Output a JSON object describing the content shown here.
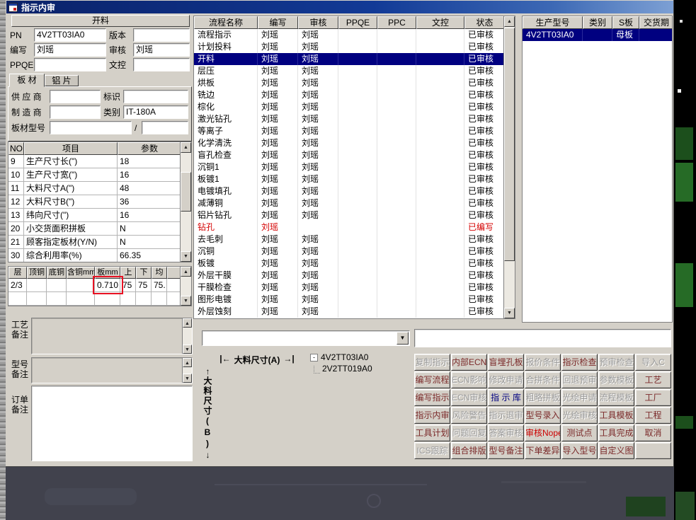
{
  "window": {
    "title": "指示内审"
  },
  "icons": {
    "minus": "-",
    "dropdown": "▼",
    "up": "▲",
    "down": "▼",
    "arrow_up": "↑",
    "arrow_down": "↓",
    "left_cap": "|←",
    "right_cap": "→|",
    "slash": "/"
  },
  "left": {
    "section_header": "开料",
    "form": {
      "pn_label": "PN",
      "pn_value": "4V2TT03IA0",
      "version_label": "版本",
      "version_value": "",
      "writer_label": "编写",
      "writer_value": "刘瑶",
      "audit_label": "审核",
      "audit_value": "刘瑶",
      "ppqe_label": "PPQE",
      "ppqe_value": "",
      "doc_label": "文控",
      "doc_value": ""
    },
    "tabs": [
      {
        "label": "板 材"
      },
      {
        "label": "铝 片"
      }
    ],
    "material": {
      "supplier_label": "供 应 商",
      "supplier_value": "",
      "mark_label": "标识",
      "mark_value": "",
      "manufacturer_label": "制 造 商",
      "manufacturer_value": "",
      "category_label": "类别",
      "category_value": "IT-180A",
      "board_model_label": "板材型号",
      "board_model_value": "",
      "board_model_value2": ""
    },
    "param_table": {
      "headers": [
        "NO",
        "项目",
        "参数"
      ],
      "rows": [
        [
          "9",
          "生产尺寸长(\")",
          "18"
        ],
        [
          "10",
          "生产尺寸宽(\")",
          "16"
        ],
        [
          "11",
          "大料尺寸A(\")",
          "48"
        ],
        [
          "12",
          "大料尺寸B(\")",
          "36"
        ],
        [
          "13",
          "纬向尺寸(\")",
          "16"
        ],
        [
          "20",
          "小交货面积拼板",
          "N"
        ],
        [
          "21",
          "顾客指定板材(Y/N)",
          "N"
        ],
        [
          "30",
          "综合利用率(%)",
          "66.35"
        ]
      ]
    },
    "copper_table": {
      "headers": [
        "层",
        "顶铜",
        "底铜",
        "含铜mm",
        "板mm",
        "上",
        "下",
        "均"
      ],
      "rows": [
        [
          "2/3",
          "",
          "",
          "",
          "0.710",
          "75",
          "75",
          "75."
        ],
        [
          "",
          "",
          "",
          "",
          "",
          "",
          "",
          ""
        ]
      ]
    },
    "notes": {
      "process_label": "工艺备注",
      "model_label": "型号备注",
      "order_label": "订单备注"
    }
  },
  "flow_table": {
    "headers": [
      "流程名称",
      "编写",
      "审核",
      "PPQE",
      "PPC",
      "文控",
      "状态"
    ],
    "selected_index": 2,
    "rows": [
      {
        "name": "流程指示",
        "writer": "刘瑶",
        "auditor": "刘瑶",
        "status": "已审核"
      },
      {
        "name": "计划投料",
        "writer": "刘瑶",
        "auditor": "刘瑶",
        "status": "已审核"
      },
      {
        "name": "开料",
        "writer": "刘瑶",
        "auditor": "刘瑶",
        "status": "已审核"
      },
      {
        "name": "层压",
        "writer": "刘瑶",
        "auditor": "刘瑶",
        "status": "已审核"
      },
      {
        "name": "烘板",
        "writer": "刘瑶",
        "auditor": "刘瑶",
        "status": "已审核"
      },
      {
        "name": "铣边",
        "writer": "刘瑶",
        "auditor": "刘瑶",
        "status": "已审核"
      },
      {
        "name": "棕化",
        "writer": "刘瑶",
        "auditor": "刘瑶",
        "status": "已审核"
      },
      {
        "name": "激光钻孔",
        "writer": "刘瑶",
        "auditor": "刘瑶",
        "status": "已审核"
      },
      {
        "name": "等离子",
        "writer": "刘瑶",
        "auditor": "刘瑶",
        "status": "已审核"
      },
      {
        "name": "化学清洗",
        "writer": "刘瑶",
        "auditor": "刘瑶",
        "status": "已审核"
      },
      {
        "name": "盲孔检查",
        "writer": "刘瑶",
        "auditor": "刘瑶",
        "status": "已审核"
      },
      {
        "name": "沉铜1",
        "writer": "刘瑶",
        "auditor": "刘瑶",
        "status": "已审核"
      },
      {
        "name": "板镀1",
        "writer": "刘瑶",
        "auditor": "刘瑶",
        "status": "已审核"
      },
      {
        "name": "电镀填孔",
        "writer": "刘瑶",
        "auditor": "刘瑶",
        "status": "已审核"
      },
      {
        "name": "减薄铜",
        "writer": "刘瑶",
        "auditor": "刘瑶",
        "status": "已审核"
      },
      {
        "name": "铝片钻孔",
        "writer": "刘瑶",
        "auditor": "刘瑶",
        "status": "已审核"
      },
      {
        "name": "钻孔",
        "writer": "刘瑶",
        "auditor": "",
        "status": "已编写",
        "red": true
      },
      {
        "name": "去毛刺",
        "writer": "刘瑶",
        "auditor": "刘瑶",
        "status": "已审核"
      },
      {
        "name": "沉铜",
        "writer": "刘瑶",
        "auditor": "刘瑶",
        "status": "已审核"
      },
      {
        "name": "板镀",
        "writer": "刘瑶",
        "auditor": "刘瑶",
        "status": "已审核"
      },
      {
        "name": "外层干膜",
        "writer": "刘瑶",
        "auditor": "刘瑶",
        "status": "已审核"
      },
      {
        "name": "干膜检查",
        "writer": "刘瑶",
        "auditor": "刘瑶",
        "status": "已审核"
      },
      {
        "name": "图形电镀",
        "writer": "刘瑶",
        "auditor": "刘瑶",
        "status": "已审核"
      },
      {
        "name": "外层蚀刻",
        "writer": "刘瑶",
        "auditor": "刘瑶",
        "status": "已审核"
      }
    ]
  },
  "middle": {
    "combo_value": "",
    "dim_a_label": "大料尺寸(A)",
    "dim_b_label": "大料尺寸(B)",
    "tree": {
      "root": "4V2TT03IA0",
      "child": "2V2TT019A0"
    }
  },
  "right_panel": {
    "headers": [
      "生产型号",
      "类别",
      "S板",
      "交货期"
    ],
    "row": [
      "4V2TT03IA0",
      "",
      "母板",
      ""
    ],
    "field_value": ""
  },
  "buttons": [
    [
      {
        "t": "复制指示",
        "m": true
      },
      {
        "t": "内部ECN"
      },
      {
        "t": "盲埋孔板"
      },
      {
        "t": "报价条件",
        "m": true
      },
      {
        "t": "指示检查"
      },
      {
        "t": "预审检查",
        "m": true
      },
      {
        "t": "导入C",
        "m": true
      }
    ],
    [
      {
        "t": "编写流程"
      },
      {
        "t": "ECN影响",
        "m": true
      },
      {
        "t": "修改申请",
        "m": true
      },
      {
        "t": "合拼条件",
        "m": true
      },
      {
        "t": "回退预审",
        "m": true
      },
      {
        "t": "参数模板",
        "m": true
      },
      {
        "t": "工艺"
      }
    ],
    [
      {
        "t": "编写指示"
      },
      {
        "t": "ECN审核",
        "m": true
      },
      {
        "t": "指 示 库",
        "c": "#000080"
      },
      {
        "t": "粗略拼板",
        "m": true
      },
      {
        "t": "光绘申请",
        "m": true
      },
      {
        "t": "流程模板",
        "m": true
      },
      {
        "t": "工厂"
      }
    ],
    [
      {
        "t": "指示内审"
      },
      {
        "t": "风险警告",
        "m": true
      },
      {
        "t": "指示退审",
        "m": true
      },
      {
        "t": "型号录入"
      },
      {
        "t": "光绘审核",
        "m": true
      },
      {
        "t": "工具模板"
      },
      {
        "t": "工程"
      }
    ],
    [
      {
        "t": "工具计划"
      },
      {
        "t": "问题回复",
        "m": true
      },
      {
        "t": "答案审核",
        "m": true
      },
      {
        "t": "审核Nope",
        "c": "#cc0000"
      },
      {
        "t": "测试点"
      },
      {
        "t": "工具完成"
      },
      {
        "t": "取消"
      }
    ],
    [
      {
        "t": "ICS跟踪",
        "m": true
      },
      {
        "t": "组合排版"
      },
      {
        "t": "型号备注"
      },
      {
        "t": "下单差异"
      },
      {
        "t": "导入型号"
      },
      {
        "t": "自定义图"
      },
      {
        "t": "",
        "m": true
      }
    ]
  ]
}
